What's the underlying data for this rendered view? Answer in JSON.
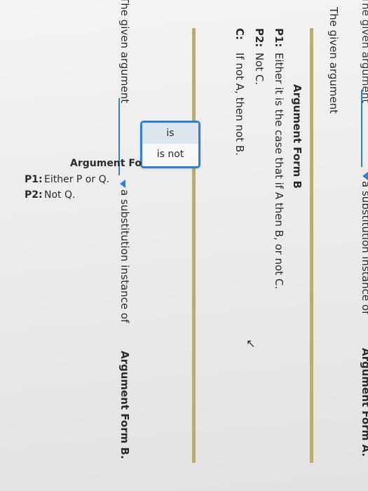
{
  "top": {
    "left_text": "The given argument",
    "right_text": "a substitution instance of",
    "form_a": "Argument Form A."
  },
  "form_b": {
    "heading": "Argument Form B",
    "premises": [
      {
        "label": "P1:",
        "text": "Either it is the case that if A then B, or not C."
      },
      {
        "label": "P2:",
        "text": "Not C."
      },
      {
        "label": "C:",
        "text": "If not A, then not B."
      }
    ]
  },
  "question_b": {
    "left_text": "The given argument",
    "right_text": "a substitution instance of",
    "form": "Argument Form B."
  },
  "dropdown": {
    "options": [
      "is",
      "is not"
    ],
    "selected": ""
  },
  "form_c_partial": {
    "heading": "Argument Fo",
    "premises": [
      {
        "label": "P1:",
        "text": "Either P or Q."
      },
      {
        "label": "P2:",
        "text": "Not Q."
      }
    ]
  },
  "colors": {
    "accent": "#2f7fd3",
    "divider": "#b9ad76"
  }
}
